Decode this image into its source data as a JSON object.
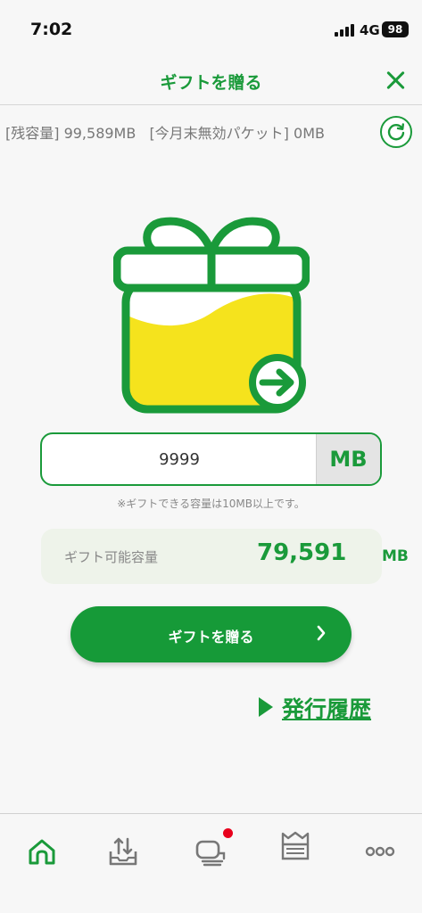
{
  "status_bar": {
    "time": "7:02",
    "network": "4G",
    "battery": "98"
  },
  "header": {
    "title": "ギフトを贈る",
    "close_icon": "close-icon"
  },
  "capacity_info": {
    "remaining": "[残容量] 99,589MB",
    "expiring": "[今月末無効パケット] 0MB",
    "refresh_icon": "refresh-icon"
  },
  "amount": {
    "value": "9999",
    "unit": "MB",
    "note": "※ギフトできる容量は10MB以上です。"
  },
  "giftable": {
    "label": "ギフト可能容量",
    "value": "79,591",
    "unit": "MB"
  },
  "gift_button": {
    "label": "ギフトを贈る"
  },
  "history_link": {
    "label": "発行履歴"
  },
  "bottom_nav": {
    "items": [
      {
        "icon": "home-icon",
        "active": true
      },
      {
        "icon": "upload-tray-icon",
        "active": false
      },
      {
        "icon": "card-stack-icon",
        "active": false,
        "badge": true
      },
      {
        "icon": "crown-icon",
        "active": false
      },
      {
        "icon": "more-icon",
        "active": false
      }
    ]
  },
  "colors": {
    "brand_green": "#1a9a3a",
    "button_green": "#169a38",
    "gift_yellow": "#f5e31d",
    "badge_red": "#e8001c"
  }
}
